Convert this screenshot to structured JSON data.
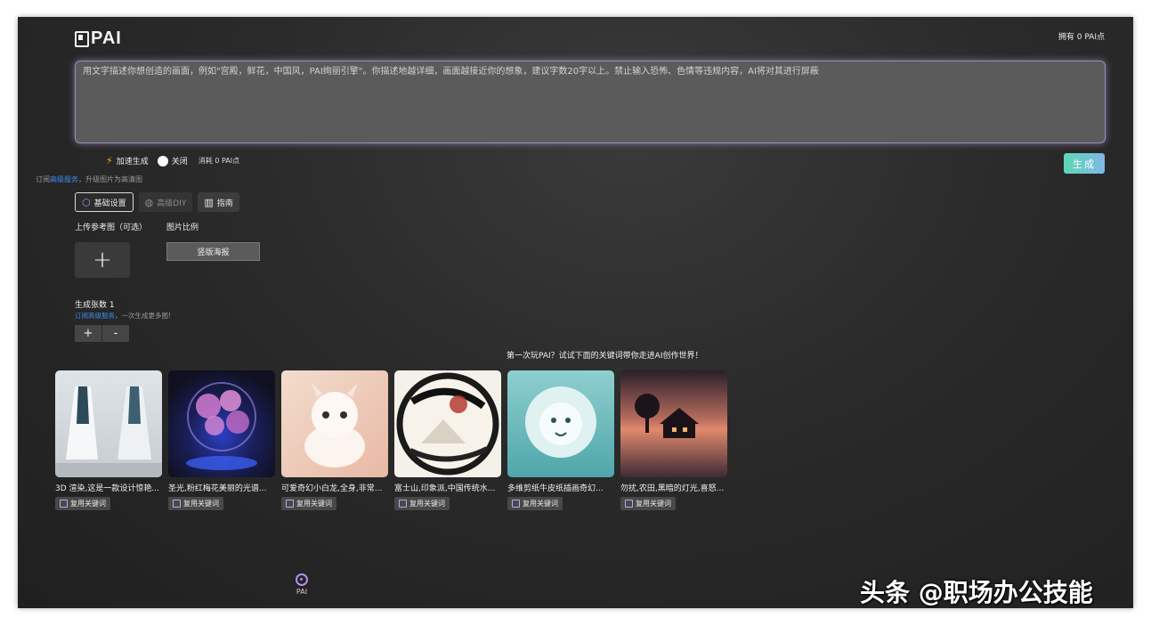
{
  "header": {
    "logo_text": "PAI",
    "points_text": "拥有 0 PAI点"
  },
  "prompt": {
    "placeholder": "用文字描述你想创造的画面，例如\"宫殿，鲜花，中国风，PAI绚丽引擎\"。你描述地越详细，画面越接近你的想象，建议字数20字以上。禁止输入恐怖、色情等违规内容，AI将对其进行屏蔽",
    "value": ""
  },
  "options": {
    "accelerate_label": "加速生成",
    "toggle_label": "关闭",
    "cost_label": "消耗 0 PAI点",
    "generate_button": "生成"
  },
  "subscribe": {
    "prefix": "订阅",
    "link": "高级服务",
    "suffix": "，升级图片为高清图"
  },
  "tabs": [
    {
      "label": "基础设置",
      "icon": "settings-icon"
    },
    {
      "label": "高级DIY",
      "icon": "palette-icon"
    },
    {
      "label": "指南",
      "icon": "map-icon"
    }
  ],
  "reference": {
    "upload_label": "上传参考图（可选）",
    "upload_button": "+",
    "ratio_label": "图片比例",
    "ratio_value": "竖版海报"
  },
  "count": {
    "label": "生成张数 1",
    "note_link": "订阅高级服务",
    "note_suffix": "，一次生成更多图!",
    "plus": "+",
    "minus": "-"
  },
  "hint": "第一次玩PAI？试试下面的关键词带你走进AI创作世界！",
  "gallery": [
    {
      "caption": "3D 渲染,这是一款设计惊艳...",
      "reuse": "复用关键词"
    },
    {
      "caption": "圣光,粉红梅花美丽的光谱...",
      "reuse": "复用关键词"
    },
    {
      "caption": "可爱奇幻小白龙,全身,非常...",
      "reuse": "复用关键词"
    },
    {
      "caption": "富士山,印象派,中国传统水...",
      "reuse": "复用关键词"
    },
    {
      "caption": "多维剪纸牛皮纸插画奇幻...",
      "reuse": "复用关键词"
    },
    {
      "caption": "勿扰,农田,黑暗的灯光,喜怒...",
      "reuse": "复用关键词"
    }
  ],
  "footer": {
    "nav_label": "PAI"
  },
  "watermark": "头条 @职场办公技能",
  "colors": {
    "accent": "#3d8cf0",
    "generate_gradient_start": "#5fd6b4",
    "generate_gradient_end": "#7fb7e6"
  }
}
